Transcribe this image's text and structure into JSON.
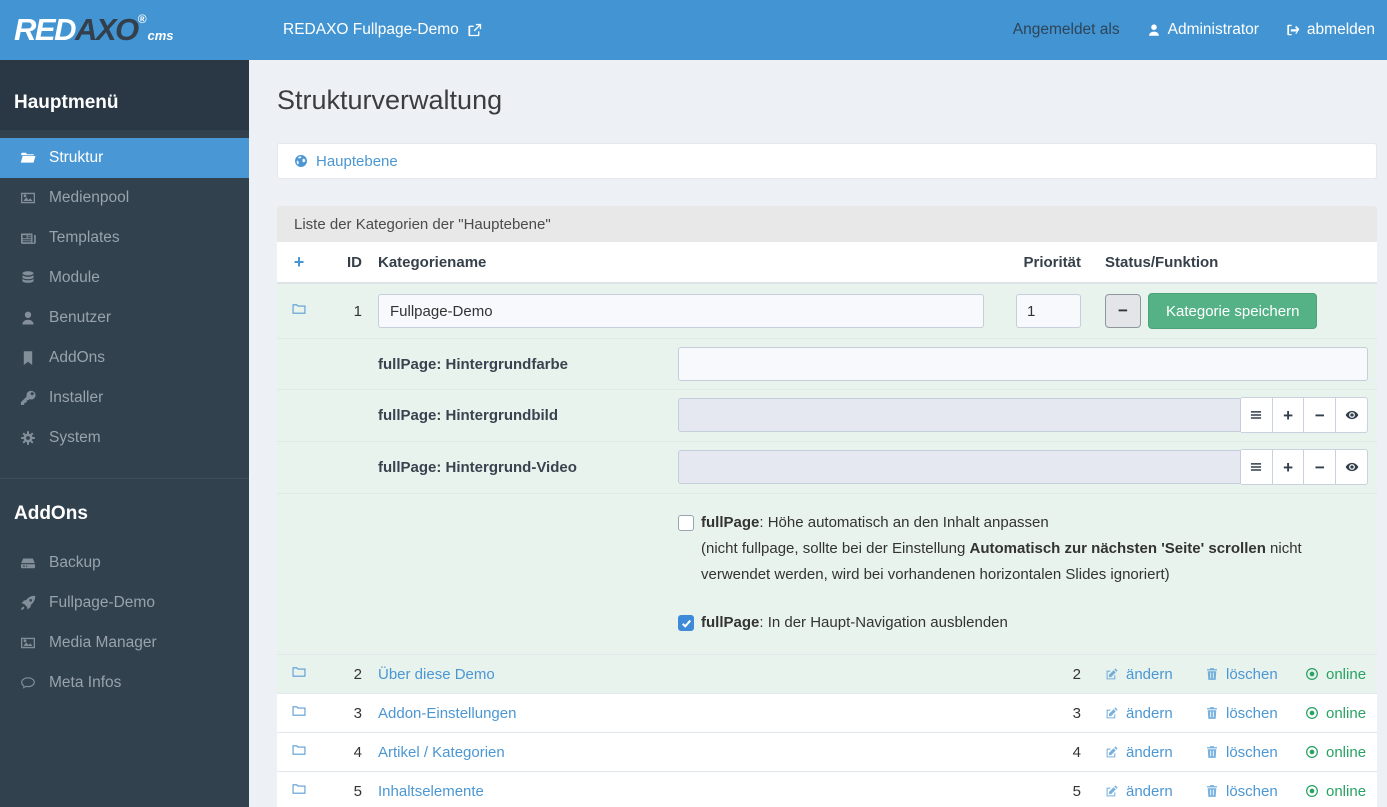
{
  "topbar": {
    "logo": {
      "part1": "RED",
      "part2": "AXO",
      "reg": "®",
      "sub": "cms"
    },
    "site_link": "REDAXO Fullpage-Demo",
    "logged_in_as": "Angemeldet als",
    "user": "Administrator",
    "logout": "abmelden"
  },
  "sidebar": {
    "main_heading": "Hauptmenü",
    "main_items": [
      {
        "label": "Struktur",
        "icon": "folder-open-icon",
        "active": true
      },
      {
        "label": "Medienpool",
        "icon": "image-icon",
        "active": false
      },
      {
        "label": "Templates",
        "icon": "newspaper-icon",
        "active": false
      },
      {
        "label": "Module",
        "icon": "database-icon",
        "active": false
      },
      {
        "label": "Benutzer",
        "icon": "user-icon",
        "active": false
      },
      {
        "label": "AddOns",
        "icon": "bookmark-icon",
        "active": false
      },
      {
        "label": "Installer",
        "icon": "key-icon",
        "active": false
      },
      {
        "label": "System",
        "icon": "gears-icon",
        "active": false
      }
    ],
    "addons_heading": "AddOns",
    "addon_items": [
      {
        "label": "Backup",
        "icon": "hdd-icon"
      },
      {
        "label": "Fullpage-Demo",
        "icon": "rocket-icon"
      },
      {
        "label": "Media Manager",
        "icon": "image-icon"
      },
      {
        "label": "Meta Infos",
        "icon": "comment-icon"
      }
    ]
  },
  "main": {
    "page_title": "Strukturverwaltung",
    "breadcrumb": {
      "root": "Hauptebene"
    },
    "panel_title": "Liste der Kategorien der \"Hauptebene\"",
    "table": {
      "headers": {
        "add": "+",
        "id": "ID",
        "name": "Kategoriename",
        "priority": "Priorität",
        "status": "Status/Funktion"
      },
      "edit_row": {
        "id": "1",
        "name_value": "Fullpage-Demo",
        "priority_value": "1",
        "minus_label": "−",
        "save_label": "Kategorie speichern"
      },
      "fields": [
        {
          "label": "fullPage: Hintergrundfarbe",
          "type": "text",
          "value": ""
        },
        {
          "label": "fullPage: Hintergrundbild",
          "type": "media",
          "value": ""
        },
        {
          "label": "fullPage: Hintergrund-Video",
          "type": "media",
          "value": ""
        }
      ],
      "media_buttons": {
        "list": "≡",
        "add": "+",
        "remove": "−",
        "view": "eye"
      },
      "checkboxes": [
        {
          "checked": false,
          "label_bold": "fullPage",
          "label_rest": ": Höhe automatisch an den Inhalt anpassen",
          "desc_pre": "(nicht fullpage, sollte bei der Einstellung ",
          "desc_bold": "Automatisch zur nächsten 'Seite' scrollen",
          "desc_post": " nicht verwendet werden, wird bei vorhandenen horizontalen Slides ignoriert)"
        },
        {
          "checked": true,
          "label_bold": "fullPage",
          "label_rest": ": In der Haupt-Navigation ausblenden"
        }
      ],
      "rows": [
        {
          "id": "2",
          "name": "Über diese Demo",
          "priority": "2",
          "edit": "ändern",
          "delete": "löschen",
          "status": "online"
        },
        {
          "id": "3",
          "name": "Addon-Einstellungen",
          "priority": "3",
          "edit": "ändern",
          "delete": "löschen",
          "status": "online"
        },
        {
          "id": "4",
          "name": "Artikel / Kategorien",
          "priority": "4",
          "edit": "ändern",
          "delete": "löschen",
          "status": "online"
        },
        {
          "id": "5",
          "name": "Inhaltselemente",
          "priority": "5",
          "edit": "ändern",
          "delete": "löschen",
          "status": "online"
        }
      ]
    }
  },
  "colors": {
    "topbar": "#4295d2",
    "sidebar": "#32414e",
    "active_item": "#4a97d5",
    "link_blue": "#4b97d3",
    "online_green": "#28a263",
    "save_green": "#55b286",
    "edit_row_bg": "#e9f3ed"
  }
}
